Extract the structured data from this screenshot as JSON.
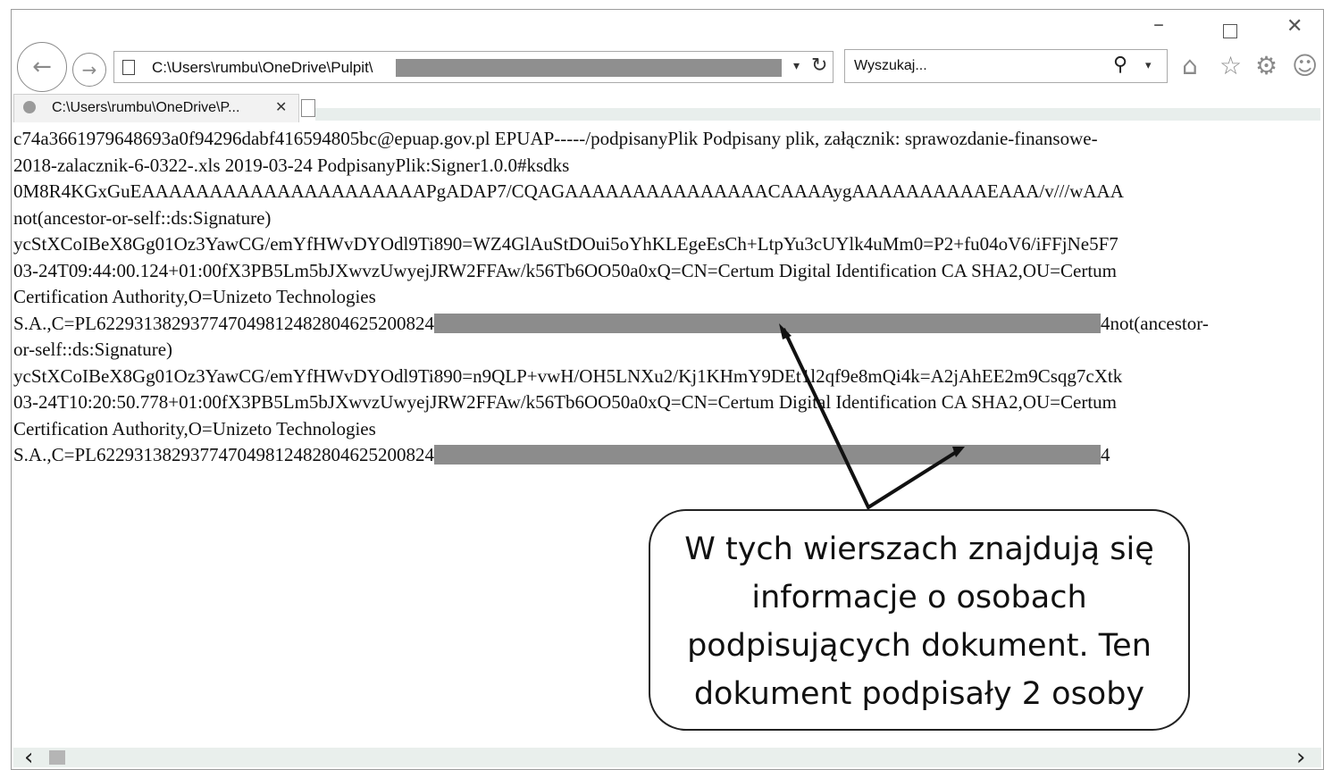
{
  "window": {
    "controls": {
      "minimize": "–",
      "maximize": "",
      "close": "✕"
    }
  },
  "navigation": {
    "back_icon": "←",
    "forward_icon": "→",
    "address": "C:\\Users\\rumbu\\OneDrive\\Pulpit\\",
    "dropdown_icon": "▾",
    "refresh_icon": "↻",
    "search_placeholder": "Wyszukaj...",
    "search_icon": "⚲",
    "search_dropdown": "▾"
  },
  "toolbar_icons": {
    "home": "⌂",
    "favorites": "☆",
    "settings": "⚙",
    "feedback": "☺"
  },
  "tab": {
    "label": "C:\\Users\\rumbu\\OneDrive\\P...",
    "close": "✕"
  },
  "document_lines": [
    {
      "text": "c74a3661979648693a0f94296dabf416594805bc@epuap.gov.pl EPUAP-----/podpisanyPlik Podpisany plik, załącznik: sprawozdanie-finansowe-"
    },
    {
      "text": "2018-zalacznik-6-0322-.xls 2019-03-24 PodpisanyPlik:Signer1.0.0#ksdks"
    },
    {
      "text": "0M8R4KGxGuEAAAAAAAAAAAAAAAAAAAAAPgADAP7/CQAGAAAAAAAAAAAAAAACAAAAygAAAAAAAAAAEAAA/v///wAAA"
    },
    {
      "text": "not(ancestor-or-self::ds:Signature)"
    },
    {
      "text": "ycStXCoIBeX8Gg01Oz3YawCG/emYfHWvDYOdl9Ti890=WZ4GlAuStDOui5oYhKLEgeEsCh+LtpYu3cUYlk4uMm0=P2+fu04oV6/iFFjNe5F7"
    },
    {
      "text": "03-24T09:44:00.124+01:00fX3PB5Lm5bJXwvzUwyejJRW2FFAw/k56Tb6OO50a0xQ=CN=Certum Digital Identification CA SHA2,OU=Certum"
    },
    {
      "text": "Certification Authority,O=Unizeto Technologies"
    },
    {
      "text": "S.A.,C=PL622931382937747049812482804625200824",
      "redacted": true,
      "after": "4not(ancestor-"
    },
    {
      "text": "or-self::ds:Signature)"
    },
    {
      "text": "ycStXCoIBeX8Gg01Oz3YawCG/emYfHWvDYOdl9Ti890=n9QLP+vwH/OH5LNXu2/Kj1KHmY9DEt1l2qf9e8mQi4k=A2jAhEE2m9Csqg7cXtk"
    },
    {
      "text": "03-24T10:20:50.778+01:00fX3PB5Lm5bJXwvzUwyejJRW2FFAw/k56Tb6OO50a0xQ=CN=Certum Digital Identification CA SHA2,OU=Certum"
    },
    {
      "text": "Certification Authority,O=Unizeto Technologies"
    },
    {
      "text": "S.A.,C=PL622931382937747049812482804625200824",
      "redacted": true,
      "after": "4"
    }
  ],
  "callout": {
    "lines": [
      "W tych wierszach znajdują się",
      "informacje o osobach",
      "podpisujących dokument. Ten",
      "dokument podpisały 2 osoby"
    ]
  },
  "scrollbar": {
    "left_arrow": "‹",
    "right_arrow": "›"
  }
}
